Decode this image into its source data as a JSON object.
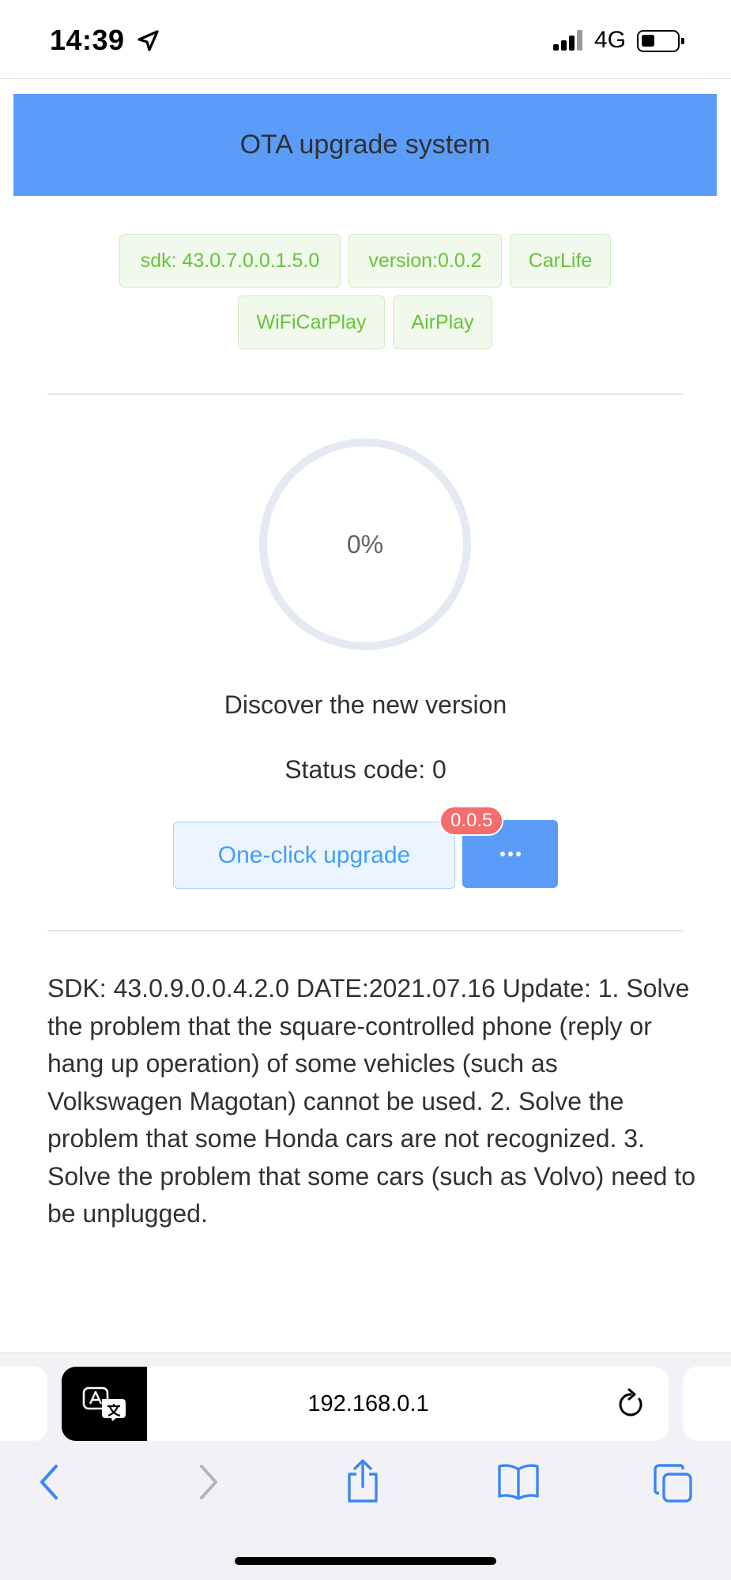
{
  "status_bar": {
    "time": "14:39",
    "network": "4G",
    "location_icon": "location-arrow-icon",
    "signal_icon": "signal-bars-icon",
    "battery_icon": "battery-icon"
  },
  "header": {
    "title": "OTA upgrade system",
    "background": "#5a9cf8"
  },
  "tags": [
    {
      "label": "sdk: 43.0.7.0.0.1.5.0"
    },
    {
      "label": "version:0.0.2"
    },
    {
      "label": "CarLife"
    },
    {
      "label": "WiFiCarPlay"
    },
    {
      "label": "AirPlay"
    }
  ],
  "progress": {
    "value": 0,
    "text": "0%"
  },
  "messages": {
    "discover": "Discover the new version",
    "status": "Status code: 0"
  },
  "actions": {
    "upgrade_label": "One-click upgrade",
    "new_version_badge": "0.0.5",
    "more_icon": "more-dots-icon"
  },
  "release_notes": "SDK: 43.0.9.0.0.4.2.0 DATE:2021.07.16  Update: 1. Solve the problem that the square-controlled phone (reply or hang up operation) of some vehicles (such as Volkswagen Magotan) cannot be used. 2. Solve the problem that some Honda cars are not recognized. 3. Solve the problem that some cars (such as Volvo) need to be unplugged.",
  "browser": {
    "url": "192.168.0.1",
    "translate_icon": "translate-icon",
    "reload_icon": "reload-icon",
    "toolbar": [
      "back-icon",
      "forward-icon",
      "share-icon",
      "bookmarks-icon",
      "tabs-icon"
    ]
  },
  "colors": {
    "accent": "#5a9cf8",
    "tag_text": "#67c23a",
    "badge": "#f56c6c",
    "progress_track": "#e5e9f2"
  }
}
